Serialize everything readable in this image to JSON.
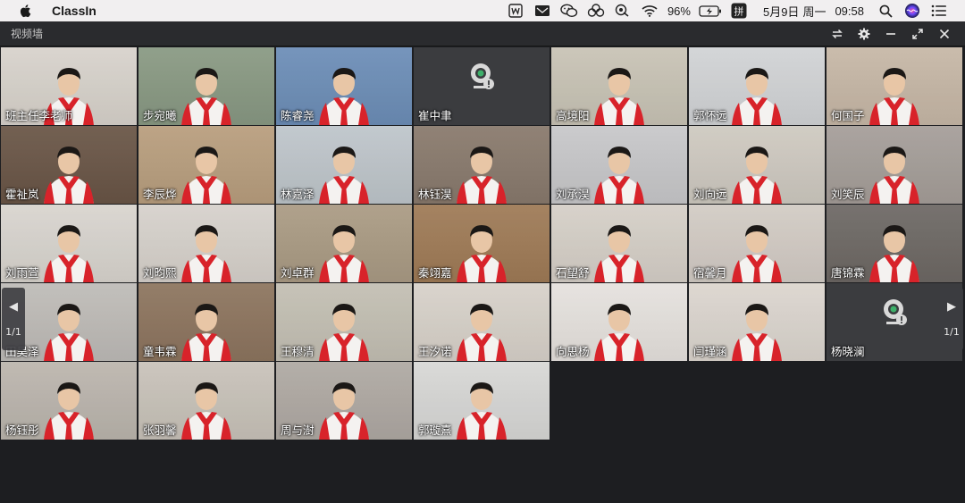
{
  "menubar": {
    "app_name": "ClassIn",
    "battery": "96%",
    "date": "5月9日",
    "weekday": "周一",
    "time": "09:58",
    "input_method": "拼"
  },
  "window": {
    "title": "视频墙"
  },
  "pager": {
    "left_label": "1/1",
    "right_label": "1/1"
  },
  "tiles": [
    {
      "name": "班主任李老师",
      "bg": "#d8d3cc",
      "cam": true
    },
    {
      "name": "步宛曦",
      "bg": "#8a9a84",
      "cam": true
    },
    {
      "name": "陈睿尧",
      "bg": "#6e8fb8",
      "cam": true
    },
    {
      "name": "崔中聿",
      "bg": "#3b3c3f",
      "cam": false
    },
    {
      "name": "高境阳",
      "bg": "#c9c4b6",
      "cam": true
    },
    {
      "name": "郭怀远",
      "bg": "#d2d4d6",
      "cam": true
    },
    {
      "name": "何国子",
      "bg": "#c7b8a7",
      "cam": true
    },
    {
      "name": "霍祉岚",
      "bg": "#6b5748",
      "cam": true
    },
    {
      "name": "李辰烨",
      "bg": "#b99f7f",
      "cam": true
    },
    {
      "name": "林嘉泽",
      "bg": "#bfc6cb",
      "cam": true
    },
    {
      "name": "林钰淏",
      "bg": "#8a7b6e",
      "cam": true
    },
    {
      "name": "刘承淏",
      "bg": "#c8c8ca",
      "cam": true
    },
    {
      "name": "刘向远",
      "bg": "#cfcac1",
      "cam": true
    },
    {
      "name": "刘笑辰",
      "bg": "#a69f9a",
      "cam": true
    },
    {
      "name": "刘雨萱",
      "bg": "#d9d5cf",
      "cam": true
    },
    {
      "name": "刘昀熙",
      "bg": "#d7d2cc",
      "cam": true
    },
    {
      "name": "刘卓群",
      "bg": "#ab9c85",
      "cam": true
    },
    {
      "name": "秦翊嘉",
      "bg": "#a07c58",
      "cam": true
    },
    {
      "name": "石望舒",
      "bg": "#d6d0c8",
      "cam": true
    },
    {
      "name": "宿馨月",
      "bg": "#d3ccc5",
      "cam": true
    },
    {
      "name": "唐锦霖",
      "bg": "#6f6a66",
      "cam": true
    },
    {
      "name": "田昊泽",
      "bg": "#bfbcb8",
      "cam": true
    },
    {
      "name": "童韦霖",
      "bg": "#8e7660",
      "cam": true
    },
    {
      "name": "王穆清",
      "bg": "#c4c0b4",
      "cam": true
    },
    {
      "name": "王汐诺",
      "bg": "#d8d2ca",
      "cam": true
    },
    {
      "name": "向思杨",
      "bg": "#e6e2de",
      "cam": true
    },
    {
      "name": "闫瑾涵",
      "bg": "#dcd6cf",
      "cam": true
    },
    {
      "name": "杨晓澜",
      "bg": "#3b3c3f",
      "cam": false
    },
    {
      "name": "杨钰彤",
      "bg": "#bcb6ae",
      "cam": true
    },
    {
      "name": "张羽馨",
      "bg": "#c9c3ba",
      "cam": true
    },
    {
      "name": "周与澍",
      "bg": "#b0aaa4",
      "cam": true
    },
    {
      "name": "郭璇熹",
      "bg": "#d8d8d6",
      "cam": true
    }
  ]
}
